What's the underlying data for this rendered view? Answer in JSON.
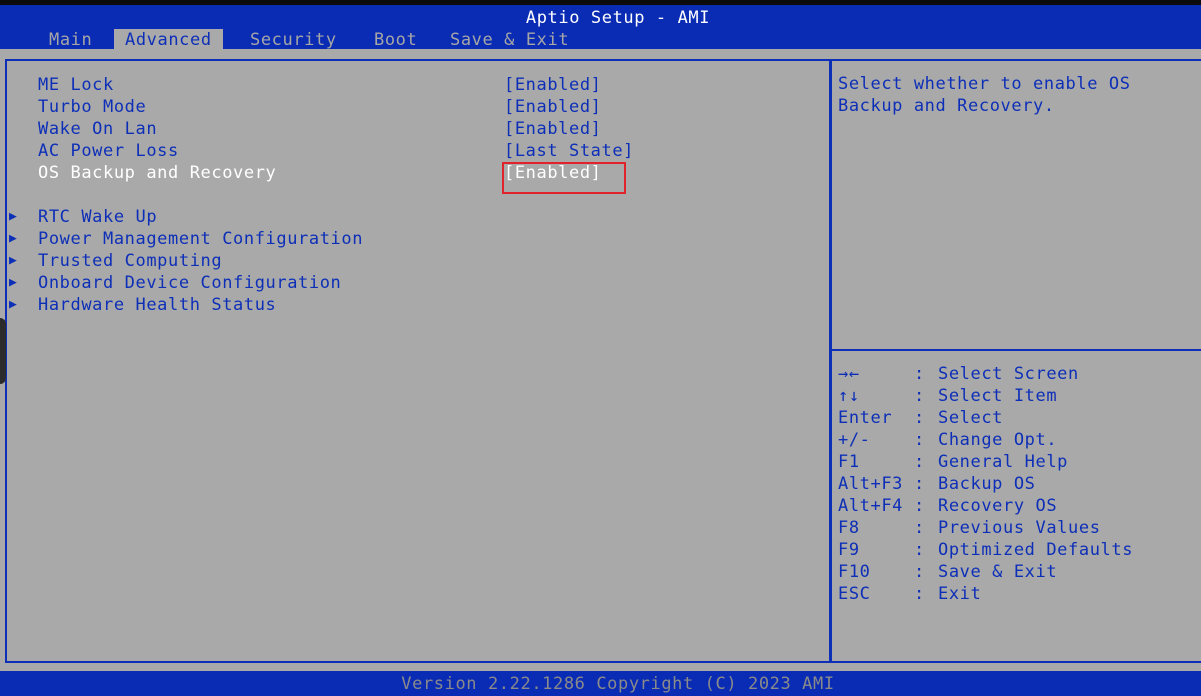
{
  "header": {
    "title": "Aptio Setup - AMI",
    "tabs": [
      {
        "label": "Main",
        "active": false
      },
      {
        "label": "Advanced",
        "active": true
      },
      {
        "label": "Security",
        "active": false
      },
      {
        "label": "Boot",
        "active": false
      },
      {
        "label": "Save & Exit",
        "active": false
      }
    ]
  },
  "settings": [
    {
      "label": "ME Lock",
      "value": "[Enabled]"
    },
    {
      "label": "Turbo Mode",
      "value": "[Enabled]"
    },
    {
      "label": "Wake On Lan",
      "value": "[Enabled]"
    },
    {
      "label": "AC Power Loss",
      "value": "[Last State]"
    },
    {
      "label": "OS Backup and Recovery",
      "value": "[Enabled]",
      "selected": true
    }
  ],
  "submenus": [
    {
      "label": "RTC Wake Up"
    },
    {
      "label": "Power Management Configuration"
    },
    {
      "label": "Trusted Computing"
    },
    {
      "label": "Onboard Device Configuration"
    },
    {
      "label": "Hardware Health Status"
    }
  ],
  "help": {
    "text": "Select whether to enable OS\nBackup and Recovery."
  },
  "keys": [
    {
      "key": "→←",
      "sep": ":",
      "desc": "Select Screen"
    },
    {
      "key": "↑↓",
      "sep": ":",
      "desc": "Select Item"
    },
    {
      "key": "Enter",
      "sep": ":",
      "desc": "Select"
    },
    {
      "key": "+/-",
      "sep": ":",
      "desc": "Change Opt."
    },
    {
      "key": "F1",
      "sep": ":",
      "desc": "General Help"
    },
    {
      "key": "Alt+F3",
      "sep": ":",
      "desc": "Backup OS"
    },
    {
      "key": "Alt+F4",
      "sep": ":",
      "desc": "Recovery OS"
    },
    {
      "key": "F8",
      "sep": ":",
      "desc": "Previous Values"
    },
    {
      "key": "F9",
      "sep": ":",
      "desc": "Optimized Defaults"
    },
    {
      "key": "F10",
      "sep": ":",
      "desc": "Save & Exit"
    },
    {
      "key": "ESC",
      "sep": ":",
      "desc": "Exit"
    }
  ],
  "footer": {
    "text": "Version 2.22.1286 Copyright (C) 2023 AMI"
  },
  "colors": {
    "header_blue": "#0a2cb4",
    "panel_gray": "#a9a9a9",
    "text_blue": "#0d2fb8",
    "selected_text": "#ffffff",
    "highlight_red": "#e0222a"
  }
}
